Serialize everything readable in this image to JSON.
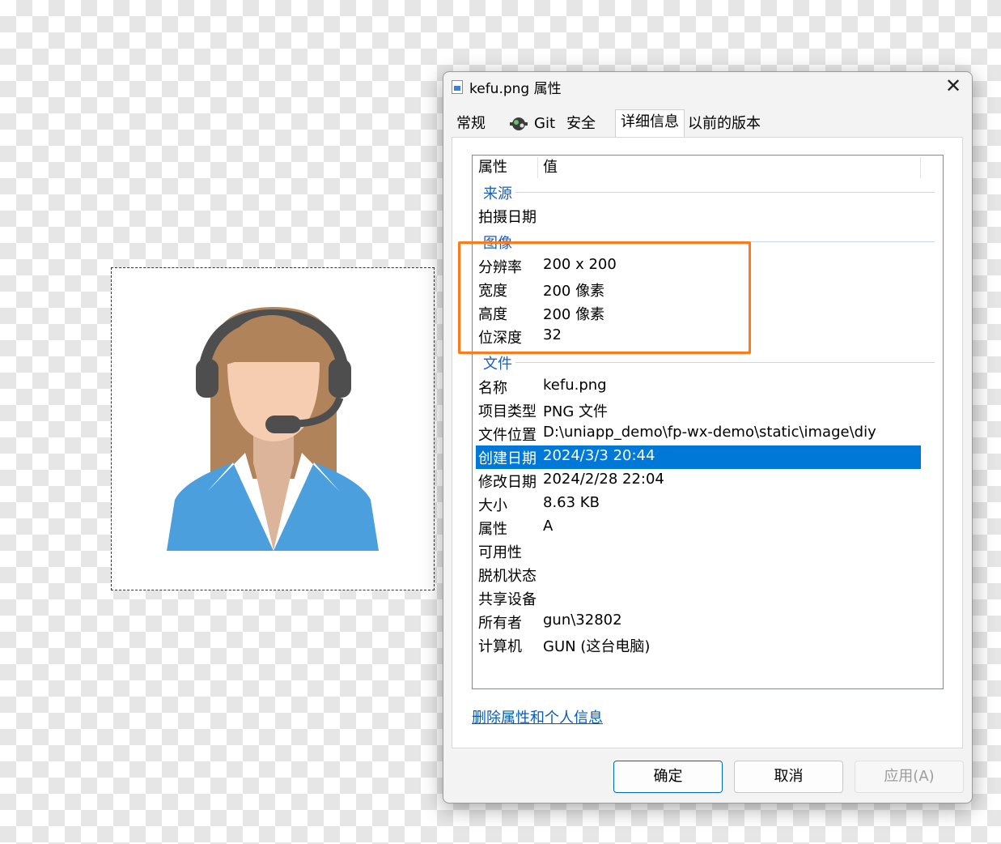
{
  "dialog": {
    "title": "kefu.png 属性",
    "close_glyph": "✕"
  },
  "tabs": [
    {
      "label": "常规"
    },
    {
      "label": "Git"
    },
    {
      "label": "安全"
    },
    {
      "label": "详细信息"
    },
    {
      "label": "以前的版本"
    }
  ],
  "details": {
    "col_property": "属性",
    "col_value": "值",
    "groups": {
      "origin": "来源",
      "image": "图像",
      "file": "文件"
    },
    "origin_rows": [
      {
        "k": "拍摄日期",
        "v": ""
      }
    ],
    "image_rows": [
      {
        "k": "分辨率",
        "v": "200 x 200"
      },
      {
        "k": "宽度",
        "v": "200 像素"
      },
      {
        "k": "高度",
        "v": "200 像素"
      },
      {
        "k": "位深度",
        "v": "32"
      }
    ],
    "file_rows": [
      {
        "k": "名称",
        "v": "kefu.png"
      },
      {
        "k": "项目类型",
        "v": "PNG 文件"
      },
      {
        "k": "文件位置",
        "v": "D:\\uniapp_demo\\fp-wx-demo\\static\\image\\diy"
      },
      {
        "k": "创建日期",
        "v": "2024/3/3 20:44"
      },
      {
        "k": "修改日期",
        "v": "2024/2/28 22:04"
      },
      {
        "k": "大小",
        "v": "8.63 KB"
      },
      {
        "k": "属性",
        "v": "A"
      },
      {
        "k": "可用性",
        "v": ""
      },
      {
        "k": "脱机状态",
        "v": ""
      },
      {
        "k": "共享设备",
        "v": ""
      },
      {
        "k": "所有者",
        "v": "gun\\32802"
      },
      {
        "k": "计算机",
        "v": "GUN (这台电脑)"
      }
    ]
  },
  "remove_link": "删除属性和个人信息",
  "buttons": {
    "ok": "确定",
    "cancel": "取消",
    "apply": "应用(A)"
  },
  "colors": {
    "selection": "#0078d7",
    "highlight_box": "#ff7a1a",
    "group_text": "#1c5fb5"
  },
  "icons": [
    "file-icon",
    "git-icon",
    "close-icon"
  ]
}
